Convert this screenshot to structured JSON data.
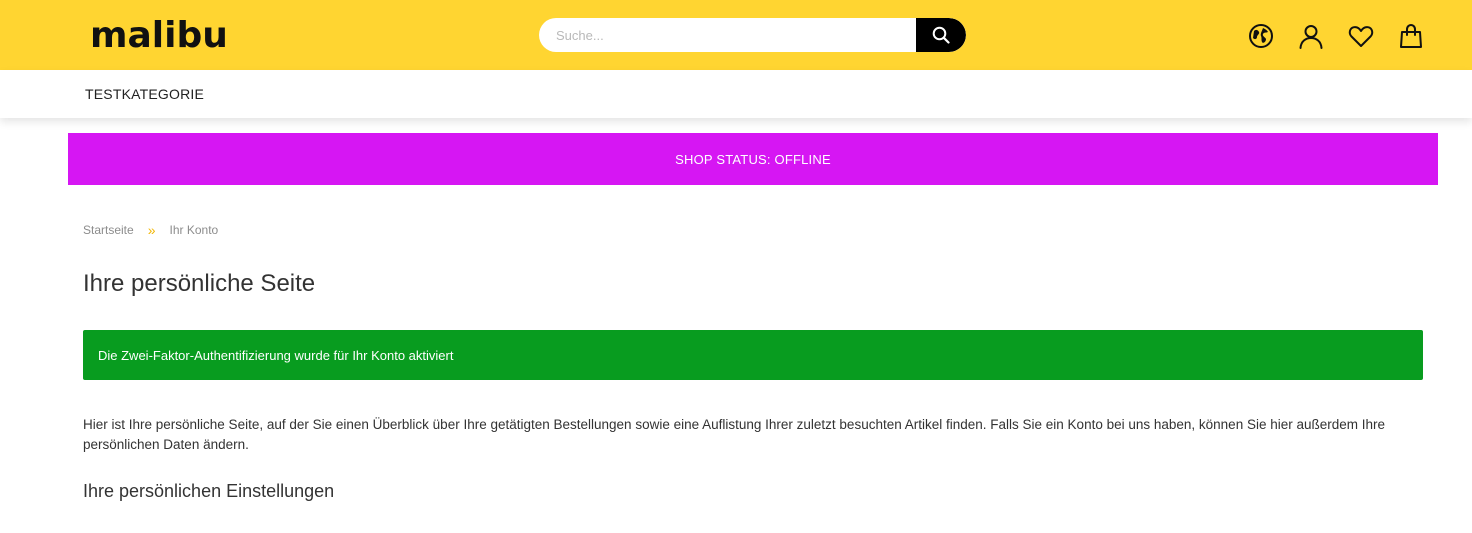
{
  "header": {
    "logo_text": "malibu",
    "search": {
      "placeholder": "Suche...",
      "value": ""
    },
    "icons": [
      "globe-icon",
      "user-icon",
      "heart-icon",
      "shopping-bag-icon"
    ]
  },
  "nav": {
    "items": [
      {
        "label": "TESTKATEGORIE"
      }
    ]
  },
  "status_banner": {
    "text": "SHOP STATUS: OFFLINE"
  },
  "breadcrumb": {
    "items": [
      {
        "label": "Startseite"
      },
      {
        "label": "Ihr Konto"
      }
    ],
    "separator": "»"
  },
  "main": {
    "title": "Ihre persönliche Seite",
    "alert": "Die Zwei-Faktor-Authentifizierung wurde für Ihr Konto aktiviert",
    "intro": "Hier ist Ihre persönliche Seite, auf der Sie einen Überblick über Ihre getätigten Bestellungen sowie eine Auflistung Ihrer zuletzt besuchten Artikel finden. Falls Sie ein Konto bei uns haben, können Sie hier außerdem Ihre persönlichen Daten ändern.",
    "section_title": "Ihre persönlichen Einstellungen"
  },
  "colors": {
    "header_bg": "#ffd531",
    "banner_bg": "#d616f3",
    "alert_bg": "#089c1f",
    "breadcrumb_separator": "#f2b705"
  }
}
